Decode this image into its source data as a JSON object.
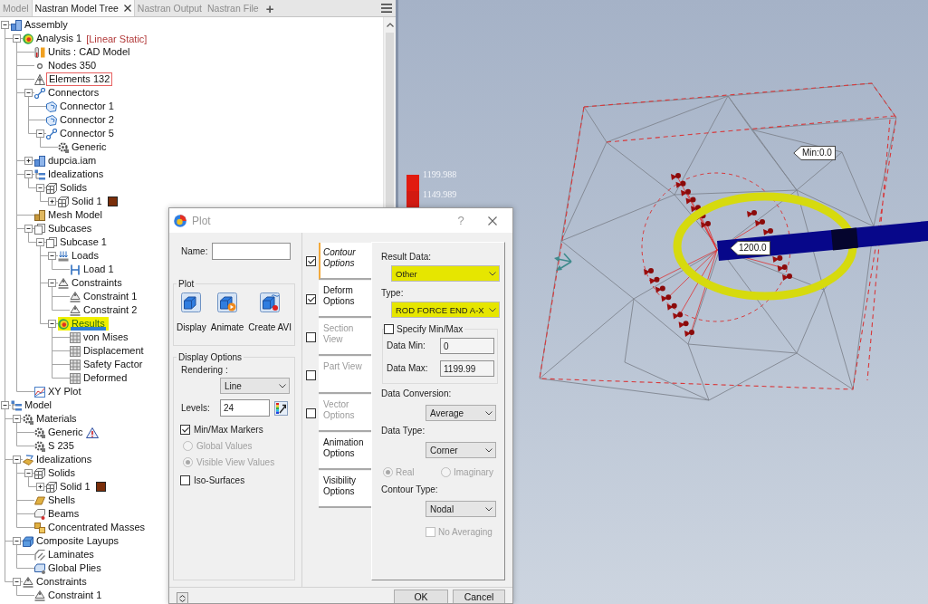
{
  "tabs": [
    {
      "label": "Model",
      "selected": false
    },
    {
      "label": "Nastran Model Tree",
      "selected": true
    },
    {
      "label": "Nastran Output",
      "selected": false
    },
    {
      "label": "Nastran File",
      "selected": false
    }
  ],
  "add_tab": "+",
  "tree": [
    {
      "label": "Assembly",
      "kind": "assembly",
      "expanded": true,
      "selected": false,
      "children": [
        {
          "label": "Analysis 1",
          "tag": "[Linear Static]",
          "kind": "analysis",
          "expanded": true,
          "selected": false,
          "children": [
            {
              "label": "Units : CAD Model",
              "kind": "units",
              "selected": false
            },
            {
              "label": "Nodes 350",
              "kind": "nodes",
              "selected": false
            },
            {
              "label": "Elements 132",
              "kind": "elements",
              "selected": false,
              "annotation": {
                "kind": "box"
              }
            },
            {
              "label": "Connectors",
              "kind": "connectors",
              "expanded": true,
              "selected": false,
              "children": [
                {
                  "label": "Connector 1",
                  "kind": "connector",
                  "selected": false
                },
                {
                  "label": "Connector 2",
                  "kind": "connector",
                  "selected": false
                },
                {
                  "label": "Connector 5",
                  "kind": "connectors",
                  "expanded": true,
                  "selected": false,
                  "children": [
                    {
                      "label": "Generic",
                      "kind": "material",
                      "selected": false
                    }
                  ]
                }
              ]
            },
            {
              "label": "dupcia.iam",
              "kind": "part",
              "expanded": false,
              "selected": false
            },
            {
              "label": "Idealizations",
              "kind": "idealizations",
              "expanded": true,
              "selected": false,
              "children": [
                {
                  "label": "Solids",
                  "kind": "solids",
                  "expanded": true,
                  "selected": false,
                  "children": [
                    {
                      "label": "Solid 1",
                      "kind": "solids",
                      "expanded": false,
                      "selected": false,
                      "color": "#7a2e0a"
                    }
                  ]
                }
              ]
            },
            {
              "label": "Mesh Model",
              "kind": "mesh_model",
              "selected": false
            },
            {
              "label": "Subcases",
              "kind": "subcases",
              "expanded": true,
              "selected": false,
              "children": [
                {
                  "label": "Subcase 1",
                  "kind": "subcases",
                  "expanded": true,
                  "selected": false,
                  "children": [
                    {
                      "label": "Loads",
                      "kind": "loads",
                      "expanded": true,
                      "selected": false,
                      "children": [
                        {
                          "label": "Load 1",
                          "kind": "load",
                          "selected": false
                        }
                      ]
                    },
                    {
                      "label": "Constraints",
                      "kind": "constraints",
                      "expanded": true,
                      "selected": false,
                      "children": [
                        {
                          "label": "Constraint 1",
                          "kind": "constraints",
                          "selected": false
                        },
                        {
                          "label": "Constraint 2",
                          "kind": "constraints",
                          "selected": false
                        }
                      ]
                    },
                    {
                      "label": "Results",
                      "kind": "results",
                      "expanded": true,
                      "selected": true,
                      "annotation": {
                        "kind": "marker"
                      },
                      "children": [
                        {
                          "label": "von Mises",
                          "kind": "result",
                          "selected": false
                        },
                        {
                          "label": "Displacement",
                          "kind": "result",
                          "selected": false
                        },
                        {
                          "label": "Safety Factor",
                          "kind": "result",
                          "selected": false
                        },
                        {
                          "label": "Deformed",
                          "kind": "result",
                          "selected": false
                        }
                      ]
                    }
                  ]
                }
              ]
            },
            {
              "label": "XY Plot",
              "kind": "xyplot",
              "selected": false
            }
          ]
        }
      ]
    },
    {
      "label": "Model",
      "kind": "model",
      "expanded": true,
      "selected": false,
      "children": [
        {
          "label": "Materials",
          "kind": "material",
          "expanded": true,
          "selected": false,
          "children": [
            {
              "label": "Generic",
              "kind": "material",
              "selected": false,
              "badge": {
                "kind": "warning"
              }
            },
            {
              "label": "S 235",
              "kind": "material",
              "selected": false
            }
          ]
        },
        {
          "label": "Idealizations",
          "kind": "shapes",
          "expanded": true,
          "selected": false,
          "children": [
            {
              "label": "Solids",
              "kind": "solids",
              "expanded": true,
              "selected": false,
              "children": [
                {
                  "label": "Solid 1",
                  "kind": "solids",
                  "expanded": false,
                  "selected": false,
                  "color": "#7a2e0a"
                }
              ]
            },
            {
              "label": "Shells",
              "kind": "shells",
              "selected": false
            },
            {
              "label": "Beams",
              "kind": "beams",
              "selected": false
            },
            {
              "label": "Concentrated Masses",
              "kind": "masses",
              "selected": false
            }
          ]
        },
        {
          "label": "Composite Layups",
          "kind": "layups",
          "expanded": true,
          "selected": false,
          "children": [
            {
              "label": "Laminates",
              "kind": "laminates",
              "selected": false
            },
            {
              "label": "Global Plies",
              "kind": "plies",
              "selected": false
            }
          ]
        },
        {
          "label": "Constraints",
          "kind": "constraints",
          "expanded": true,
          "selected": false,
          "children": [
            {
              "label": "Constraint 1",
              "kind": "constraints",
              "selected": false
            }
          ]
        }
      ]
    }
  ],
  "viewport": {
    "legend": [
      "1199.988",
      "1149.989"
    ],
    "callouts": [
      "Min:0.0",
      "1200.0"
    ]
  },
  "dialog": {
    "title": "Plot",
    "help": "?",
    "name_label": "Name:",
    "plot_group": {
      "title": "Plot",
      "buttons": [
        {
          "kind": "display",
          "label": "Display"
        },
        {
          "kind": "animate",
          "label": "Animate"
        },
        {
          "kind": "avi",
          "label": "Create AVI"
        }
      ]
    },
    "display_options": {
      "title": "Display Options",
      "rendering": {
        "label": "Rendering :",
        "value": "Line"
      },
      "levels": {
        "label": "Levels:",
        "value": "24"
      },
      "options": [
        {
          "kind": "checkbox",
          "label": "Min/Max Markers",
          "checked": true,
          "disabled": false
        },
        {
          "kind": "radio",
          "label": "Global Values",
          "selected": false,
          "disabled": true
        },
        {
          "kind": "radio",
          "label": "Visible View Values",
          "selected": true,
          "disabled": true
        },
        {
          "kind": "checkbox",
          "label": "Iso-Surfaces",
          "checked": false,
          "disabled": false
        }
      ]
    },
    "option_tabs": [
      {
        "label": "Contour Options",
        "selected": true,
        "disabled": false,
        "checkbox": {
          "checked": true
        }
      },
      {
        "label": "Deform Options",
        "selected": false,
        "disabled": false,
        "checkbox": {
          "checked": true
        }
      },
      {
        "label": "Section View",
        "selected": false,
        "disabled": true,
        "checkbox": {
          "checked": false
        }
      },
      {
        "label": "Part View",
        "selected": false,
        "disabled": true,
        "checkbox": {
          "checked": false
        }
      },
      {
        "label": "Vector Options",
        "selected": false,
        "disabled": true,
        "checkbox": {
          "checked": false
        }
      },
      {
        "label": "Animation Options",
        "selected": false,
        "disabled": false
      },
      {
        "label": "Visibility Options",
        "selected": false,
        "disabled": false
      }
    ],
    "contour": {
      "result_data": {
        "label": "Result Data:",
        "value": "Other",
        "annotation": {
          "kind": "marker"
        }
      },
      "type": {
        "label": "Type:",
        "value": "ROD FORCE END A-X",
        "annotation": {
          "kind": "marker"
        }
      },
      "min_max": {
        "label": "Specify Min/Max",
        "checked": false,
        "data_min": {
          "label": "Data Min:",
          "value": "0"
        },
        "data_max": {
          "label": "Data Max:",
          "value": "1199.99"
        }
      },
      "data_conversion": {
        "label": "Data Conversion:",
        "value": "Average"
      },
      "data_type": {
        "label": "Data Type:",
        "value": "Corner"
      },
      "value_parts": [
        {
          "label": "Real",
          "selected": true,
          "disabled": true
        },
        {
          "label": "Imaginary",
          "selected": false,
          "disabled": true
        }
      ],
      "contour_type": {
        "label": "Contour Type:",
        "value": "Nodal"
      },
      "no_averaging": {
        "label": "No Averaging",
        "checked": false,
        "disabled": true
      }
    },
    "buttons": [
      "OK",
      "Cancel"
    ]
  }
}
